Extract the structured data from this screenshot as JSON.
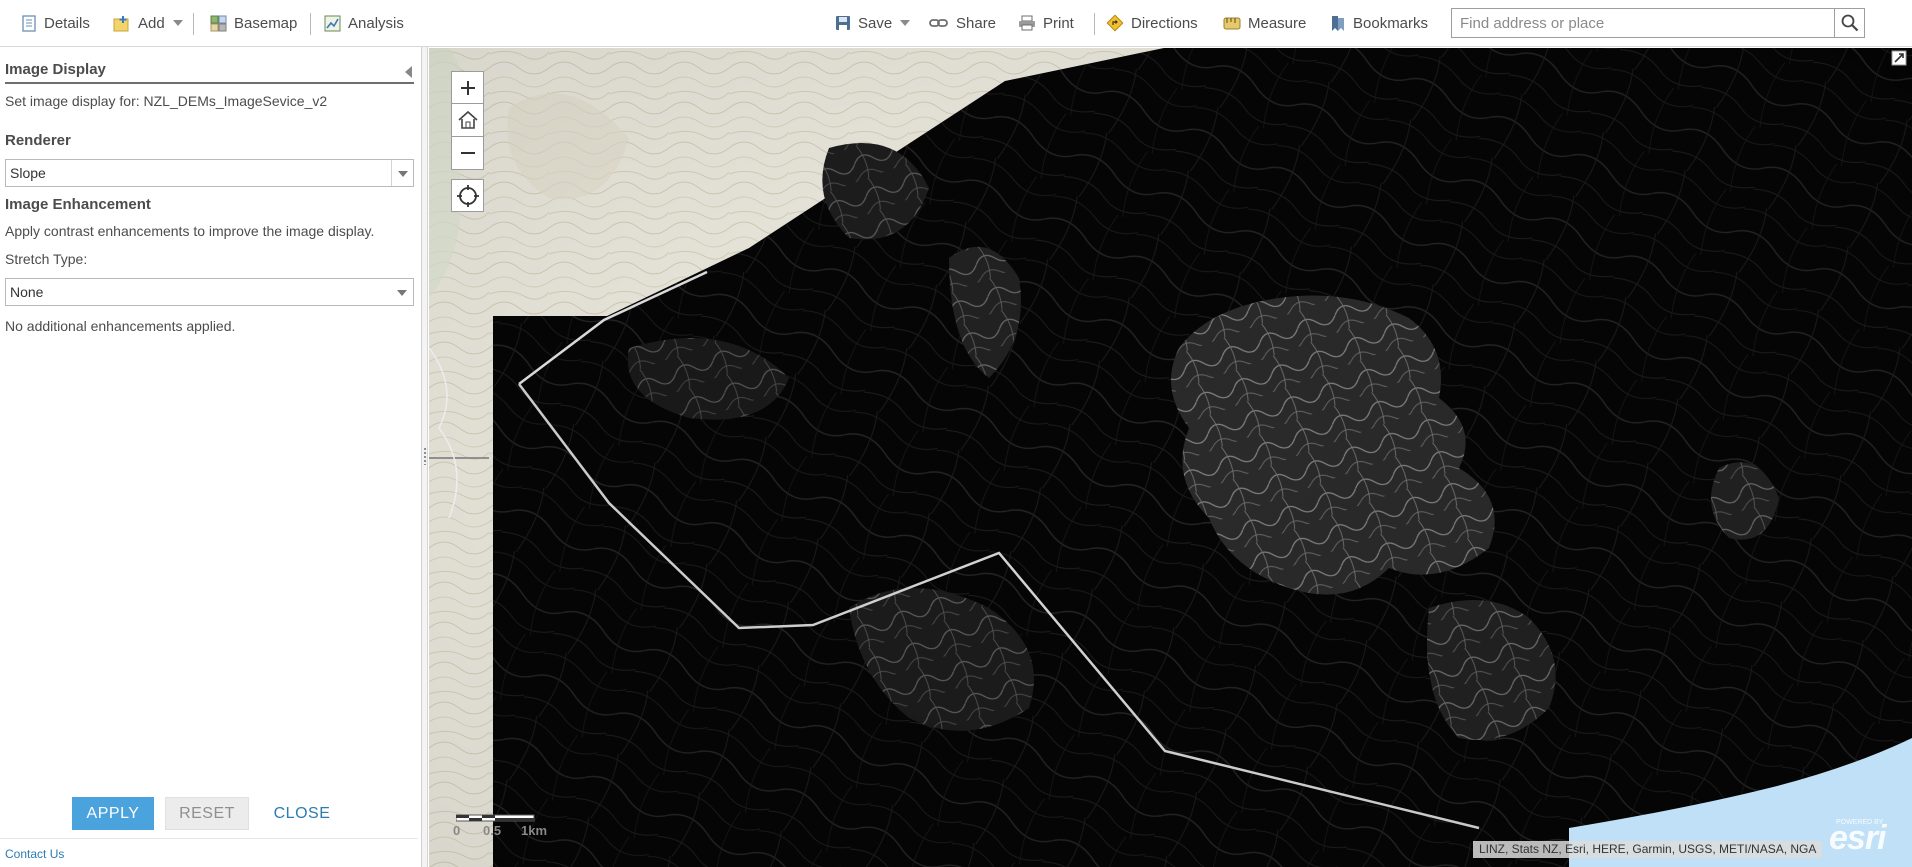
{
  "toolbar": {
    "details": "Details",
    "add": "Add",
    "basemap": "Basemap",
    "analysis": "Analysis",
    "save": "Save",
    "share": "Share",
    "print": "Print",
    "directions": "Directions",
    "measure": "Measure",
    "bookmarks": "Bookmarks",
    "search_placeholder": "Find address or place"
  },
  "panel": {
    "title": "Image Display",
    "set_display_for": "Set image display for: NZL_DEMs_ImageSevice_v2",
    "renderer_label": "Renderer",
    "renderer_value": "Slope",
    "enhancement_label": "Image Enhancement",
    "enhancement_desc": "Apply contrast enhancements to improve the image display.",
    "stretch_label": "Stretch Type:",
    "stretch_value": "None",
    "no_enhancements": "No additional enhancements applied.",
    "apply": "APPLY",
    "reset": "RESET",
    "close": "CLOSE",
    "contact": "Contact Us"
  },
  "map": {
    "scale_labels": [
      "0",
      "0.5",
      "1km"
    ],
    "attribution": "LINZ, Stats NZ, Esri, HERE, Garmin, USGS, METI/NASA, NGA",
    "logo_text": "esri",
    "logo_powered": "POWERED BY"
  },
  "colors": {
    "accent": "#4ba3de",
    "link": "#2b7cb3",
    "topo_bg": "#f2efe4",
    "water": "#bfe0f7",
    "image_black": "#050505"
  },
  "icons": [
    "details-icon",
    "add-icon",
    "basemap-icon",
    "analysis-icon",
    "save-icon",
    "share-icon",
    "print-icon",
    "directions-icon",
    "measure-icon",
    "bookmarks-icon",
    "search-icon",
    "zoom-in-icon",
    "home-icon",
    "zoom-out-icon",
    "locate-icon",
    "fullscreen-icon"
  ]
}
